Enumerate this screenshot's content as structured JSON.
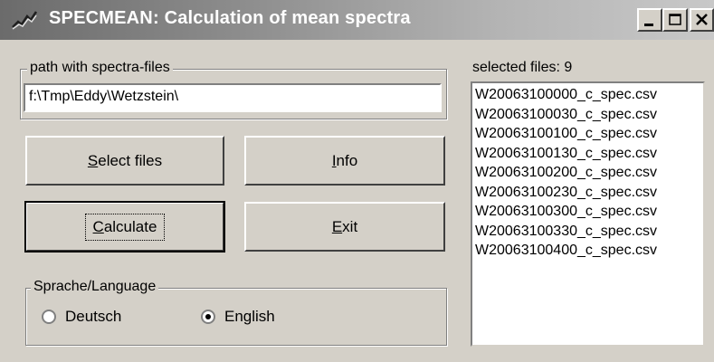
{
  "window": {
    "title": "SPECMEAN: Calculation of mean spectra",
    "app_icon": "spectrum-line-icon",
    "controls": {
      "minimize": "minimize-icon",
      "maximize": "maximize-icon",
      "close": "close-icon"
    }
  },
  "path_group": {
    "legend": "path with spectra-files",
    "value": "f:\\Tmp\\Eddy\\Wetzstein\\"
  },
  "buttons": {
    "select_files": {
      "mnemonic": "S",
      "rest": "elect files"
    },
    "info": {
      "mnemonic": "I",
      "rest": "nfo"
    },
    "calculate": {
      "mnemonic": "C",
      "rest": "alculate"
    },
    "exit": {
      "mnemonic": "E",
      "rest": "xit"
    }
  },
  "language_group": {
    "legend": "Sprache/Language",
    "options": [
      {
        "label": "Deutsch",
        "selected": false
      },
      {
        "label": "English",
        "selected": true
      }
    ]
  },
  "files": {
    "label": "selected files: 9",
    "items": [
      "W20063100000_c_spec.csv",
      "W20063100030_c_spec.csv",
      "W20063100100_c_spec.csv",
      "W20063100130_c_spec.csv",
      "W20063100200_c_spec.csv",
      "W20063100230_c_spec.csv",
      "W20063100300_c_spec.csv",
      "W20063100330_c_spec.csv",
      "W20063100400_c_spec.csv"
    ]
  }
}
